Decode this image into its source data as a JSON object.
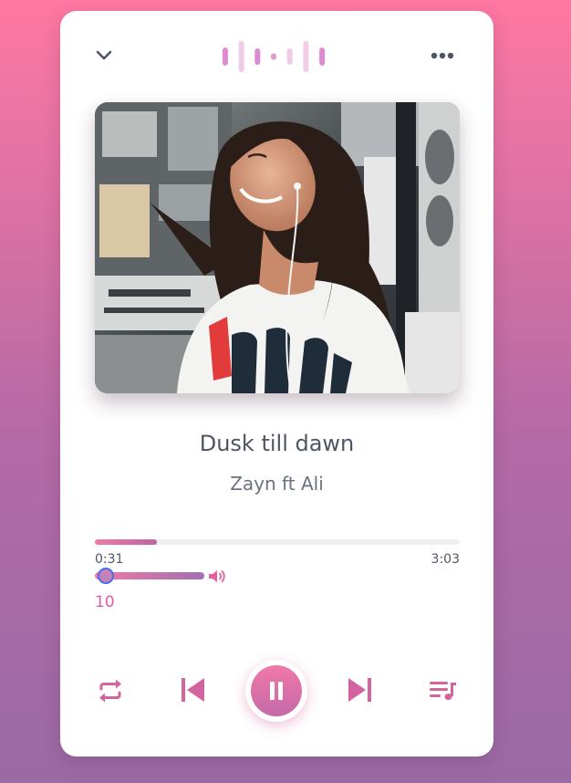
{
  "player": {
    "visualizer_bars": [
      0.55,
      0.95,
      0.5,
      0.2,
      0.5,
      0.95,
      0.55
    ],
    "song_title": "Dusk till dawn",
    "artist": "Zayn ft Ali",
    "current_time": "0:31",
    "duration": "3:03",
    "progress": 0.17,
    "volume": 10,
    "volume_label": "10"
  },
  "icons": {
    "top_left": "chevron-down-icon",
    "top_right": "more-horizontal-icon",
    "volume": "volume-icon",
    "repeat": "repeat-icon",
    "previous": "skip-previous-icon",
    "play_pause": "pause-icon",
    "next": "skip-next-icon",
    "queue": "queue-music-icon"
  },
  "colors": {
    "accent": "#e05a9e",
    "accent_light": "#f27aa8",
    "accent_purple": "#a26fb0",
    "text_dark": "#4e5664",
    "text_muted": "#6b7280"
  }
}
